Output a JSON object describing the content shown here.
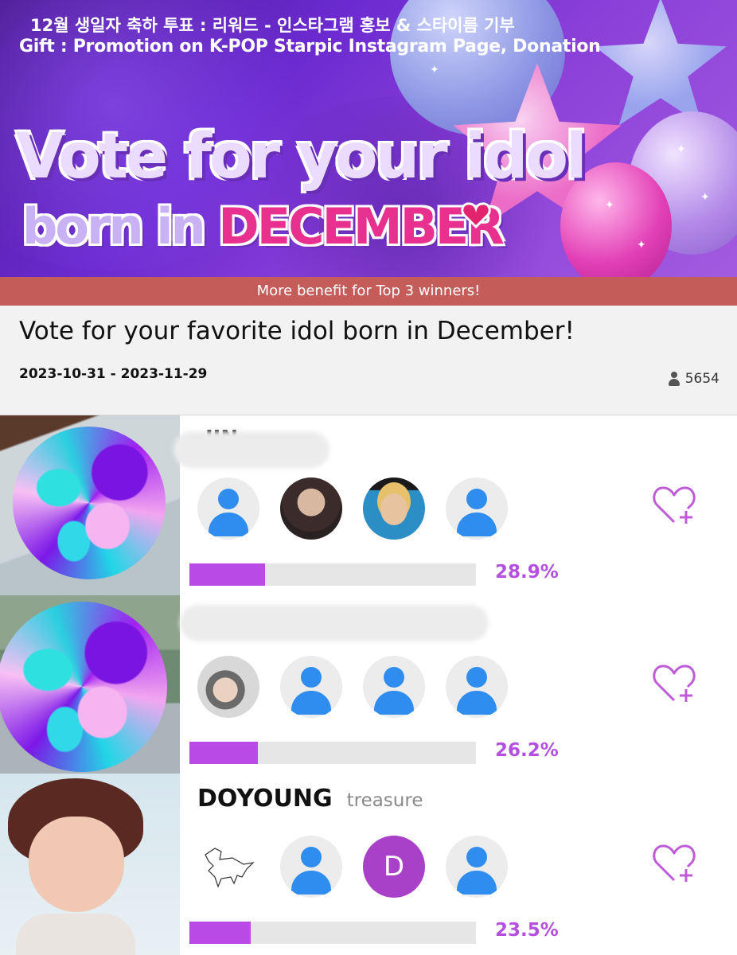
{
  "banner": {
    "line1": "12월 생일자 축하 투표 : 리워드 - 인스타그램 홍보 & 스타이름 기부",
    "line2": "Gift : Promotion on K-POP Starpic Instagram Page, Donation",
    "headline1": "Vote for your idol",
    "headline2_a": "born in ",
    "headline2_b": "DECEMBER",
    "benefit": "More benefit for Top 3 winners!"
  },
  "vote": {
    "title": "Vote for your favorite idol born in December!",
    "dates": "2023-10-31 - 2023-11-29",
    "participants": "5654"
  },
  "candidates": [
    {
      "name": "JIN",
      "group": "",
      "name_obscured": true,
      "percent_label": "28.9%",
      "percent": 28.9,
      "supporters": [
        "default-avatar",
        "photo-avatar",
        "photo-avatar",
        "default-avatar"
      ]
    },
    {
      "name": "",
      "group": "",
      "name_obscured": true,
      "percent_label": "26.2%",
      "percent": 26.2,
      "supporters": [
        "photo-avatar",
        "default-avatar",
        "default-avatar",
        "default-avatar"
      ]
    },
    {
      "name": "DOYOUNG",
      "group": "treasure",
      "name_obscured": false,
      "percent_label": "23.5%",
      "percent": 23.5,
      "supporters": [
        "sketch-avatar",
        "default-avatar",
        "letter-avatar",
        "default-avatar"
      ],
      "letter": "D"
    }
  ],
  "icons": {
    "participants": "person-icon",
    "vote": "heart-plus-icon"
  },
  "colors": {
    "accent": "#b94ae6",
    "benefit_bar": "#c45d5a",
    "default_avatar": "#2f8df0"
  }
}
